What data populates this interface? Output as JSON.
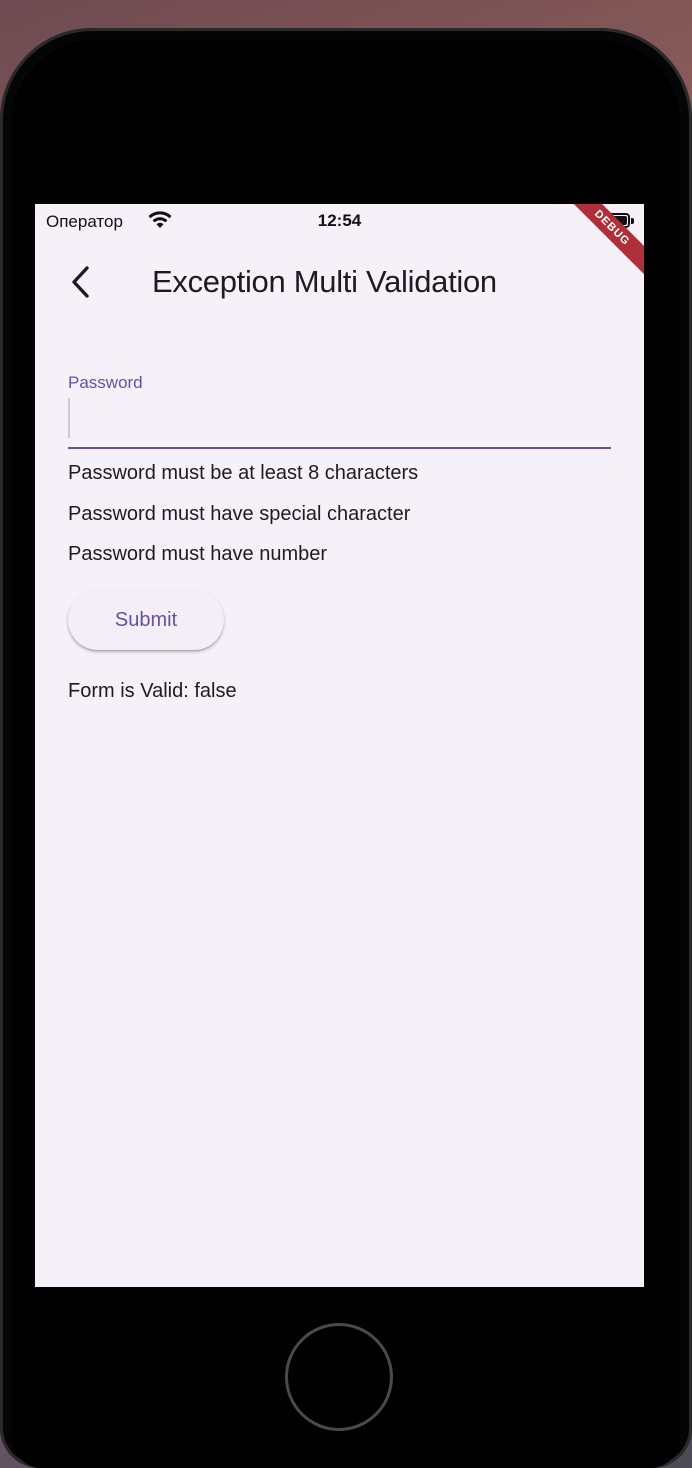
{
  "status_bar": {
    "carrier": "Оператор",
    "time": "12:54",
    "wifi_icon": "wifi-icon",
    "battery_icon": "battery-icon"
  },
  "debug_banner": "DEBUG",
  "app_bar": {
    "back_icon": "chevron-left-icon",
    "title": "Exception Multi Validation"
  },
  "form": {
    "password_label": "Password",
    "password_value": "",
    "errors": [
      "Password must be at least 8 characters",
      "Password must have special character",
      "Password must have number"
    ],
    "submit_label": "Submit",
    "valid_text": "Form is Valid: false"
  },
  "colors": {
    "primary": "#6750a4",
    "background": "#f6f1f8",
    "debug_banner": "#b0303a"
  }
}
